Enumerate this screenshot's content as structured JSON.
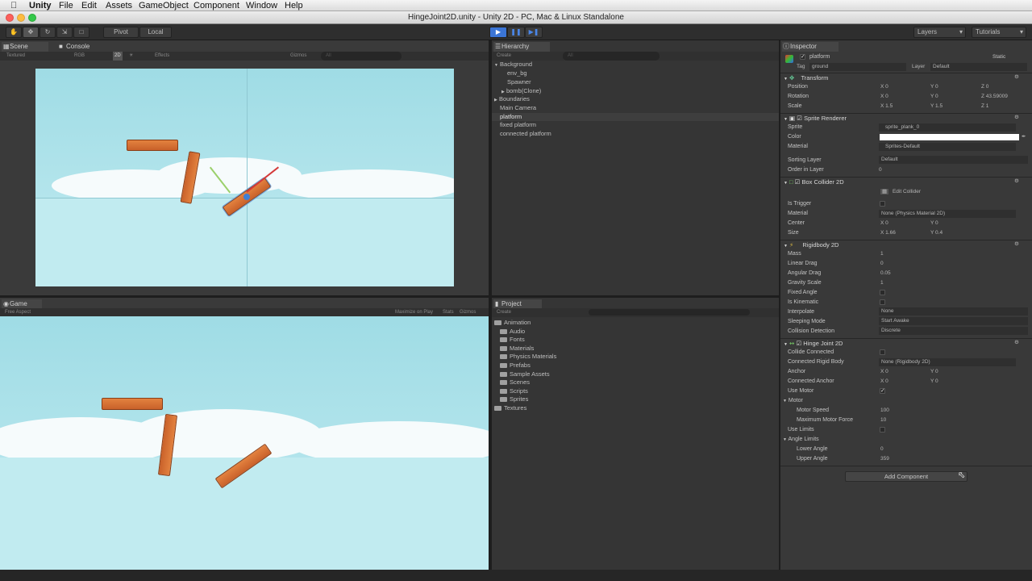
{
  "menubar": {
    "app": "Unity",
    "items": [
      "File",
      "Edit",
      "Assets",
      "GameObject",
      "Component",
      "Window",
      "Help"
    ]
  },
  "window_title": "HingeJoint2D.unity - Unity 2D - PC, Mac & Linux Standalone",
  "toolbar": {
    "pivot": "Pivot",
    "local": "Local",
    "layers": "Layers",
    "layout": "Tutorials"
  },
  "scene": {
    "tab": "Scene",
    "tab2": "Console",
    "shading": "Textured",
    "rgb": "RGB",
    "mode2d": "2D",
    "effects": "Effects",
    "gizmos": "Gizmos",
    "search": "All"
  },
  "game": {
    "tab": "Game",
    "aspect": "Free Aspect",
    "maximize": "Maximize on Play",
    "stats": "Stats",
    "gizmos": "Gizmos"
  },
  "hierarchy": {
    "tab": "Hierarchy",
    "create": "Create",
    "search": "All",
    "items": [
      "Background",
      "env_bg",
      "Spawner",
      "bomb(Clone)",
      "Boundaries",
      "Main Camera",
      "platform",
      "fixed platform",
      "connected platform"
    ]
  },
  "project": {
    "tab": "Project",
    "create": "Create",
    "folders": [
      "Animation",
      "Audio",
      "Fonts",
      "Materials",
      "Physics Materials",
      "Prefabs",
      "Sample Assets",
      "Scenes",
      "Scripts",
      "Sprites",
      "Textures"
    ]
  },
  "inspector": {
    "tab": "Inspector",
    "name": "platform",
    "static": "Static",
    "tag_label": "Tag",
    "tag": "ground",
    "layer_label": "Layer",
    "layer": "Default",
    "transform": {
      "title": "Transform",
      "position": "Position",
      "rotation": "Rotation",
      "scale": "Scale",
      "pos": [
        "0",
        "0",
        "0"
      ],
      "rot": [
        "0",
        "0",
        "43.59009"
      ],
      "scl": [
        "1.5",
        "1.5",
        "1"
      ]
    },
    "sprite_renderer": {
      "title": "Sprite Renderer",
      "sprite_label": "Sprite",
      "sprite": "sprite_plank_0",
      "color_label": "Color",
      "material_label": "Material",
      "material": "Sprites-Default",
      "sorting_label": "Sorting Layer",
      "sorting": "Default",
      "order_label": "Order in Layer",
      "order": "0"
    },
    "box_collider": {
      "title": "Box Collider 2D",
      "edit": "Edit Collider",
      "trigger": "Is Trigger",
      "material_label": "Material",
      "material": "None (Physics Material 2D)",
      "center": "Center",
      "center_vals": [
        "0",
        "0"
      ],
      "size": "Size",
      "size_vals": [
        "1.66",
        "0.4"
      ]
    },
    "rigidbody": {
      "title": "Rigidbody 2D",
      "mass": "Mass",
      "mass_val": "1",
      "linear": "Linear Drag",
      "linear_val": "0",
      "angular": "Angular Drag",
      "angular_val": "0.05",
      "gravity": "Gravity Scale",
      "gravity_val": "1",
      "fixed": "Fixed Angle",
      "kinematic": "Is Kinematic",
      "interpolate": "Interpolate",
      "interpolate_val": "None",
      "sleeping": "Sleeping Mode",
      "sleeping_val": "Start Awake",
      "collision": "Collision Detection",
      "collision_val": "Discrete"
    },
    "hinge": {
      "title": "Hinge Joint 2D",
      "collide": "Collide Connected",
      "connected_body": "Connected Rigid Body",
      "connected_body_val": "None (Rigidbody 2D)",
      "anchor": "Anchor",
      "anchor_vals": [
        "0",
        "0"
      ],
      "conn_anchor": "Connected Anchor",
      "conn_anchor_vals": [
        "0",
        "0"
      ],
      "use_motor": "Use Motor",
      "motor": "Motor",
      "motor_speed": "Motor Speed",
      "motor_speed_val": "100",
      "max_force": "Maximum Motor Force",
      "max_force_val": "10",
      "use_limits": "Use Limits",
      "angle_limits": "Angle Limits",
      "lower": "Lower Angle",
      "lower_val": "0",
      "upper": "Upper Angle",
      "upper_val": "359"
    },
    "add_component": "Add Component",
    "axes": [
      "X",
      "Y",
      "Z"
    ]
  }
}
